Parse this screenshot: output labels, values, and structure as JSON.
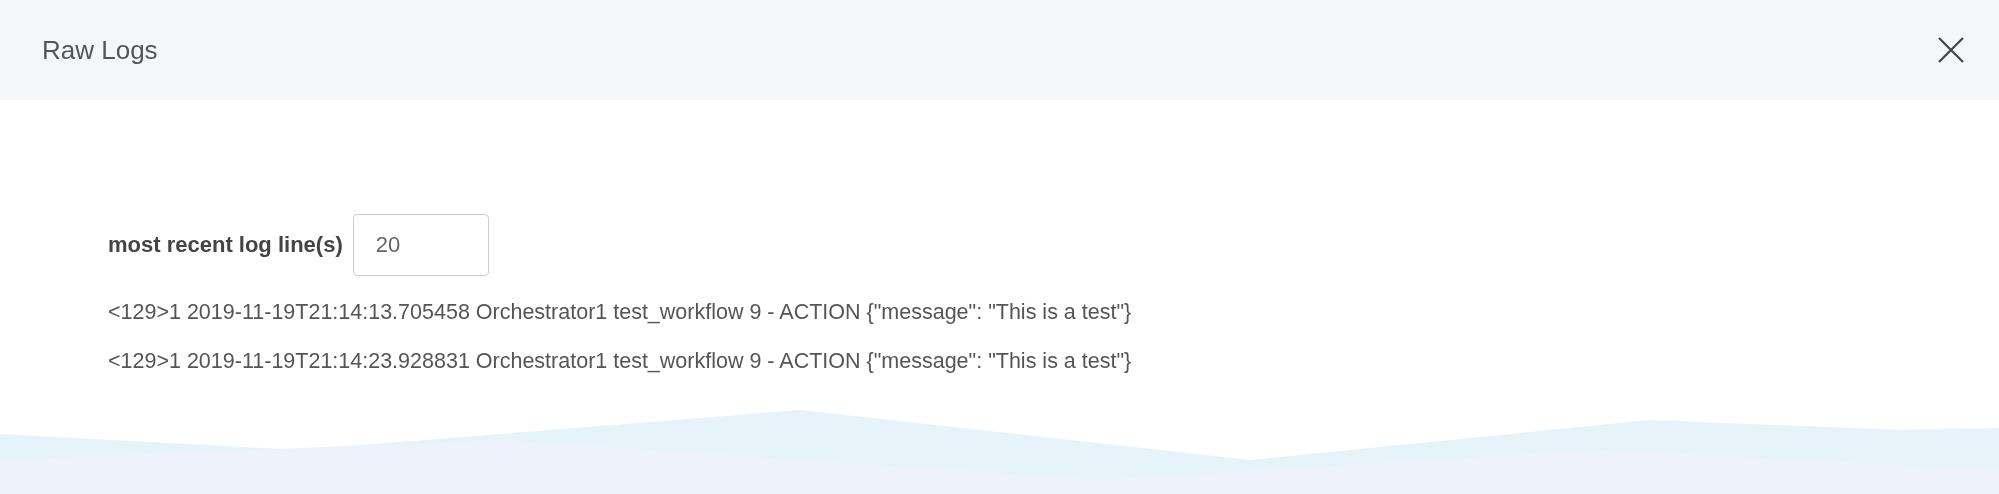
{
  "dialog": {
    "title": "Raw Logs"
  },
  "line_count": {
    "label": "most recent log line(s)",
    "value": "20"
  },
  "log_lines": [
    "<129>1 2019-11-19T21:14:13.705458 Orchestrator1 test_workflow 9 - ACTION {\"message\": \"This is a test\"}",
    "<129>1 2019-11-19T21:14:23.928831 Orchestrator1 test_workflow 9 - ACTION {\"message\": \"This is a test\"}"
  ]
}
